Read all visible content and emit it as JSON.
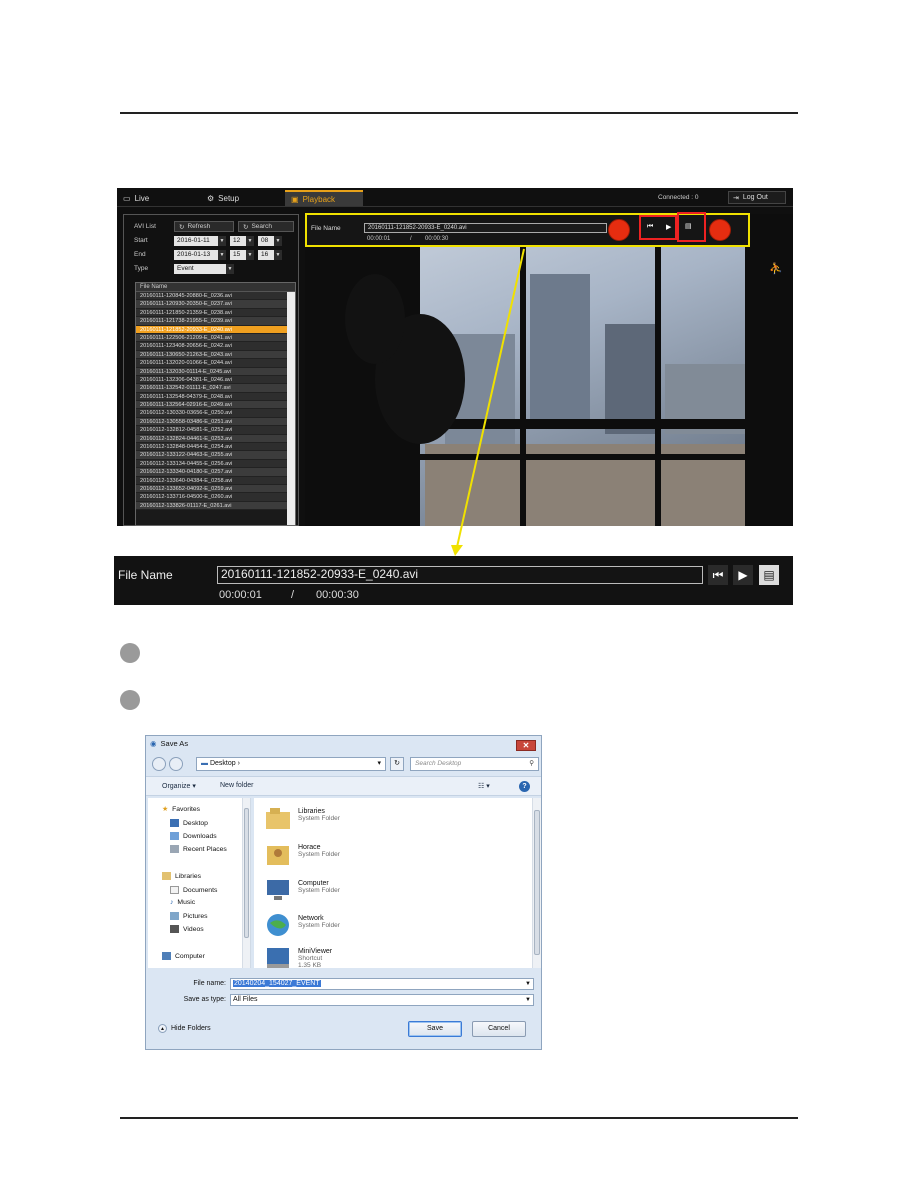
{
  "app": {
    "tabs": [
      {
        "label": "Live"
      },
      {
        "label": "Setup"
      },
      {
        "label": "Playback"
      }
    ],
    "connected_text": "Connected : 0",
    "logout_label": "Log Out",
    "search_panel": {
      "avi_list_label": "AVI List",
      "refresh_label": "Refresh",
      "search_label": "Search",
      "start_label": "Start",
      "start_date": "2016-01-11",
      "start_hour": "12",
      "start_min": "08",
      "end_label": "End",
      "end_date": "2016-01-13",
      "end_hour": "15",
      "end_min": "16",
      "type_label": "Type",
      "type_value": "Event",
      "file_list_header": "File Name",
      "files": [
        "20160111-120845-20880-E_0236.avi",
        "20160111-120930-20350-E_0237.avi",
        "20160111-121850-21359-E_0238.avi",
        "20160111-121738-21955-E_0239.avi",
        "20160111-121852-20933-E_0240.avi",
        "20160111-122506-21209-E_0241.avi",
        "20160111-123408-20656-E_0242.avi",
        "20160111-130650-21263-E_0243.avi",
        "20160111-132020-01066-E_0244.avi",
        "20160111-132030-01114-E_0245.avi",
        "20160111-132306-04381-E_0246.avi",
        "20160111-132542-01111-E_0247.avi",
        "20160111-132548-04379-E_0248.avi",
        "20160111-132564-02916-E_0249.avi",
        "20160112-130330-03656-E_0250.avi",
        "20160112-130558-03486-E_0251.avi",
        "20160112-132812-04581-E_0252.avi",
        "20160112-132824-04461-E_0253.avi",
        "20160112-132848-04454-E_0254.avi",
        "20160112-133122-04463-E_0255.avi",
        "20160112-133134-04455-E_0256.avi",
        "20160112-133340-04180-E_0257.avi",
        "20160112-133640-04384-E_0258.avi",
        "20160112-133652-04092-E_0259.avi",
        "20160112-133716-04500-E_0260.avi",
        "20160112-133826-01117-E_0261.avi"
      ],
      "active_index": 4
    },
    "player": {
      "file_name_label": "File Name",
      "file_name": "20160111-121852-20933-E_0240.avi",
      "current_time": "00:00:01",
      "separator": "/",
      "total_time": "00:00:30"
    }
  },
  "zoom": {
    "file_name_label": "File Name",
    "file_name": "20160111-121852-20933-E_0240.avi",
    "current_time": "00:00:01",
    "separator": "/",
    "total_time": "00:00:30"
  },
  "dialog": {
    "title": "Save As",
    "address": "Desktop",
    "search_placeholder": "Search Desktop",
    "organize_label": "Organize",
    "new_folder_label": "New folder",
    "nav": {
      "favorites": "Favorites",
      "desktop": "Desktop",
      "downloads": "Downloads",
      "recent_places": "Recent Places",
      "libraries": "Libraries",
      "documents": "Documents",
      "music": "Music",
      "pictures": "Pictures",
      "videos": "Videos",
      "computer": "Computer"
    },
    "items": [
      {
        "name": "Libraries",
        "sub": "System Folder",
        "icon": "libraries-icon"
      },
      {
        "name": "Horace",
        "sub": "System Folder",
        "icon": "user-folder-icon"
      },
      {
        "name": "Computer",
        "sub": "System Folder",
        "icon": "computer-icon"
      },
      {
        "name": "Network",
        "sub": "System Folder",
        "icon": "network-icon"
      },
      {
        "name": "MiniViewer",
        "sub": "Shortcut",
        "sub2": "1.35 KB",
        "icon": "shortcut-icon"
      }
    ],
    "file_name_label": "File name:",
    "file_name_value": "20140204_154027_EVENT",
    "save_type_label": "Save as type:",
    "save_type_value": "All Files",
    "hide_folders_label": "Hide Folders",
    "save_label": "Save",
    "cancel_label": "Cancel"
  },
  "colors": {
    "highlight_yellow": "#f0e100",
    "callout_red": "#e62d10",
    "playback_orange": "#e8a21a",
    "selected_file": "#f0a020"
  }
}
